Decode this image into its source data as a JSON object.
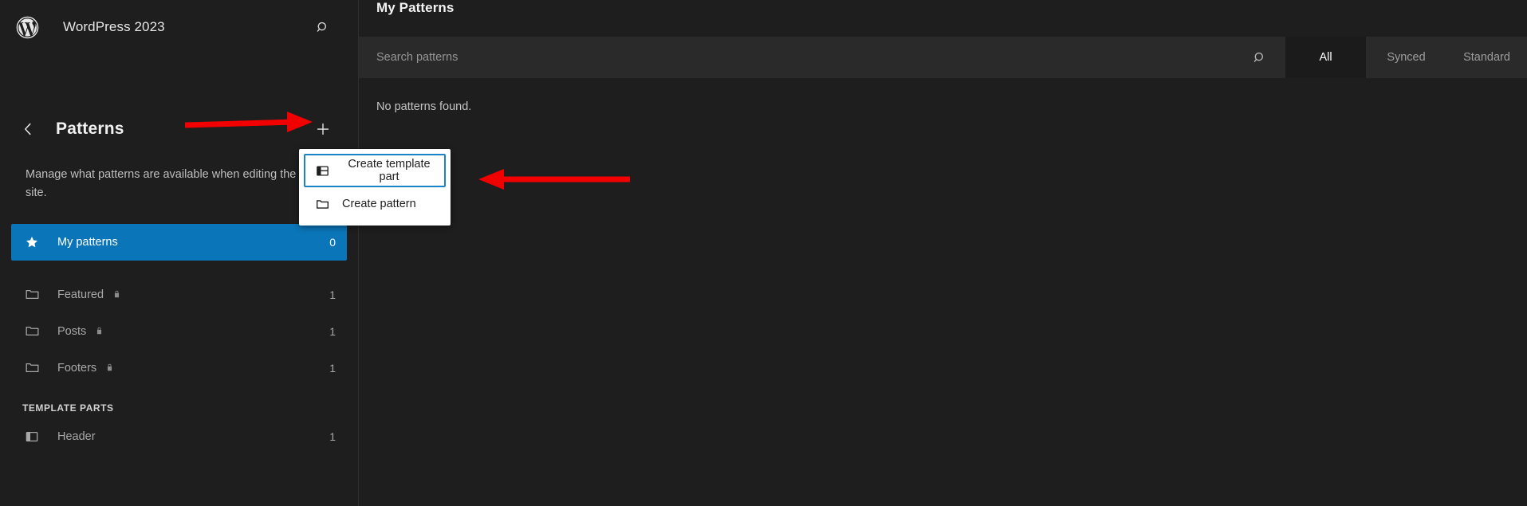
{
  "colors": {
    "accent_blue": "#0b75b9",
    "focus_blue": "#1a84c7",
    "annotation_red": "#f20000",
    "sidebar_bg": "#1e1e1e",
    "input_bg": "#2a2a2a",
    "menu_bg": "#ffffff"
  },
  "site_header": {
    "logo_icon": "wordpress-logo",
    "title": "WordPress 2023",
    "search_icon": "search-icon"
  },
  "patterns_panel": {
    "back_icon": "chevron-left-icon",
    "title": "Patterns",
    "add_icon": "plus-icon",
    "description": "Manage what patterns are available when editing the site.",
    "items": [
      {
        "icon": "star-icon",
        "label": "My patterns",
        "count": "0",
        "locked": false,
        "selected": true
      },
      {
        "icon": "folder-icon",
        "label": "Featured",
        "count": "1",
        "locked": true,
        "selected": false
      },
      {
        "icon": "folder-icon",
        "label": "Posts",
        "count": "1",
        "locked": true,
        "selected": false
      },
      {
        "icon": "folder-icon",
        "label": "Footers",
        "count": "1",
        "locked": true,
        "selected": false
      }
    ],
    "template_parts_label": "TEMPLATE PARTS",
    "template_parts": [
      {
        "icon": "template-part-icon",
        "label": "Header",
        "count": "1"
      }
    ]
  },
  "main": {
    "title": "My Patterns",
    "search": {
      "placeholder": "Search patterns",
      "value": "",
      "icon": "search-icon"
    },
    "tabs": [
      {
        "label": "All",
        "active": true
      },
      {
        "label": "Synced",
        "active": false
      },
      {
        "label": "Standard",
        "active": false
      }
    ],
    "empty_message": "No patterns found."
  },
  "dropdown_menu": {
    "items": [
      {
        "icon": "template-part-icon",
        "label": "Create template part",
        "focused": true
      },
      {
        "icon": "folder-icon",
        "label": "Create pattern",
        "focused": false
      }
    ]
  },
  "annotations": [
    {
      "name": "arrow-to-add-button",
      "direction": "right"
    },
    {
      "name": "arrow-to-create-template-part",
      "direction": "left"
    }
  ]
}
